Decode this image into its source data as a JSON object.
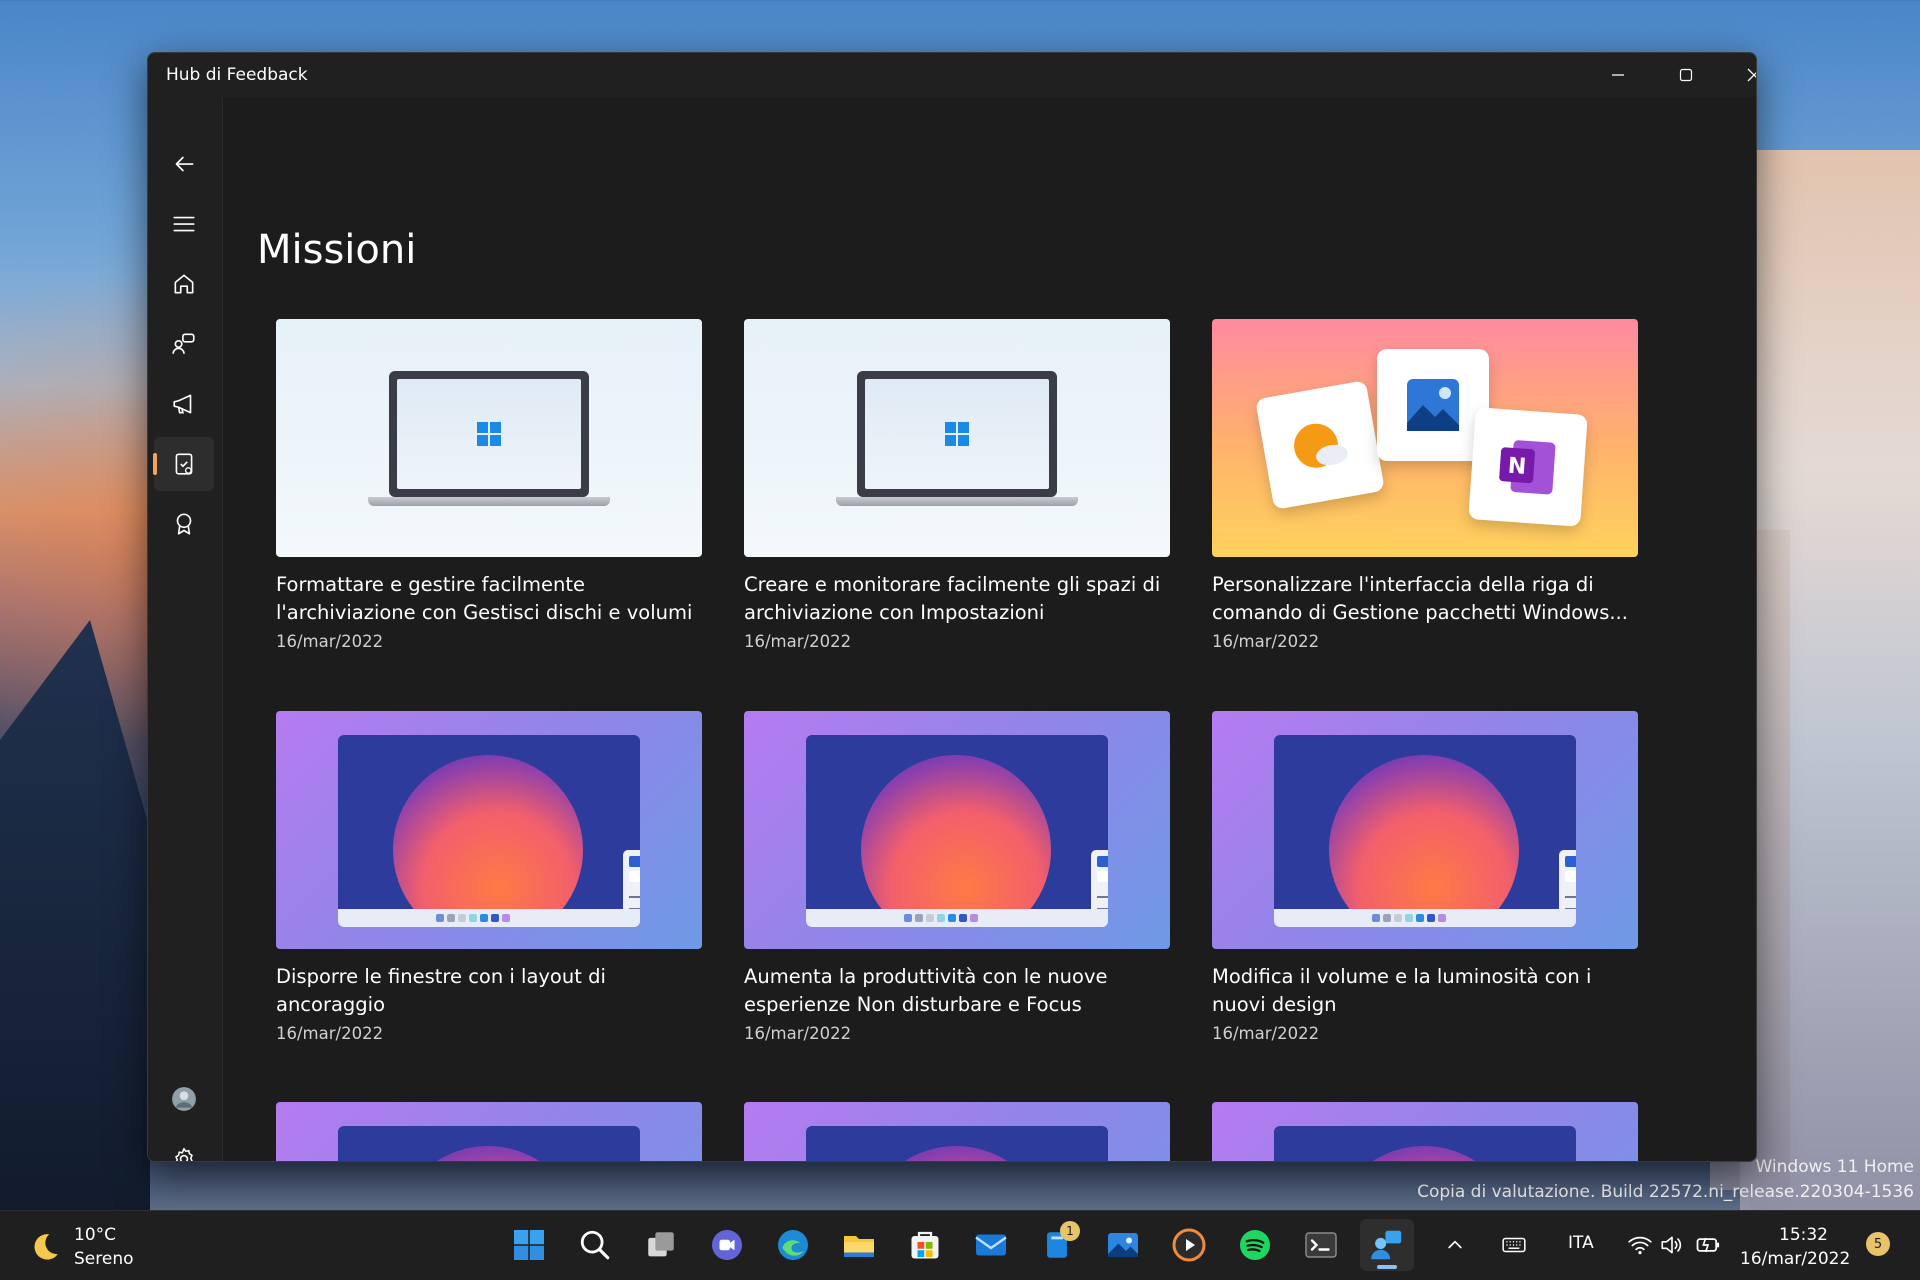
{
  "window": {
    "title": "Hub di Feedback"
  },
  "page": {
    "title": "Missioni"
  },
  "nav": {
    "items": [
      {
        "icon": "back-arrow-icon"
      },
      {
        "icon": "hamburger-menu-icon"
      },
      {
        "icon": "home-icon"
      },
      {
        "icon": "feedback-icon"
      },
      {
        "icon": "announcements-icon"
      },
      {
        "icon": "quests-icon",
        "active": true
      },
      {
        "icon": "achievements-icon"
      },
      {
        "icon": "profile-avatar"
      },
      {
        "icon": "settings-gear-icon"
      }
    ]
  },
  "cards": [
    {
      "title": "Formattare e gestire facilmente l'archiviazione con Gestisci dischi e volumi",
      "date": "16/mar/2022",
      "image": "laptop"
    },
    {
      "title": "Creare e monitorare facilmente gli spazi di archiviazione con Impostazioni",
      "date": "16/mar/2022",
      "image": "laptop"
    },
    {
      "title": "Personalizzare l'interfaccia della riga di comando di Gestione pacchetti Windows...",
      "date": "16/mar/2022",
      "image": "apps"
    },
    {
      "title": "Disporre le finestre con i layout di ancoraggio",
      "date": "16/mar/2022",
      "image": "desktop"
    },
    {
      "title": "Aumenta la produttività con le nuove esperienze Non disturbare e Focus",
      "date": "16/mar/2022",
      "image": "desktop"
    },
    {
      "title": "Modifica il volume e la luminosità con i nuovi design",
      "date": "16/mar/2022",
      "image": "desktop"
    }
  ],
  "desktop": {
    "watermark_line1": "Windows 11 Home",
    "watermark_line2": "Copia di valutazione. Build 22572.ni_release.220304-1536"
  },
  "taskbar": {
    "weather_temp": "10°C",
    "weather_desc": "Sereno",
    "store_badge": "1",
    "language": "ITA",
    "time": "15:32",
    "date": "16/mar/2022",
    "notifications": "5"
  },
  "colors": {
    "accent": "#f0a45a",
    "window_bg": "#202020",
    "content_bg": "#1c1c1c"
  }
}
